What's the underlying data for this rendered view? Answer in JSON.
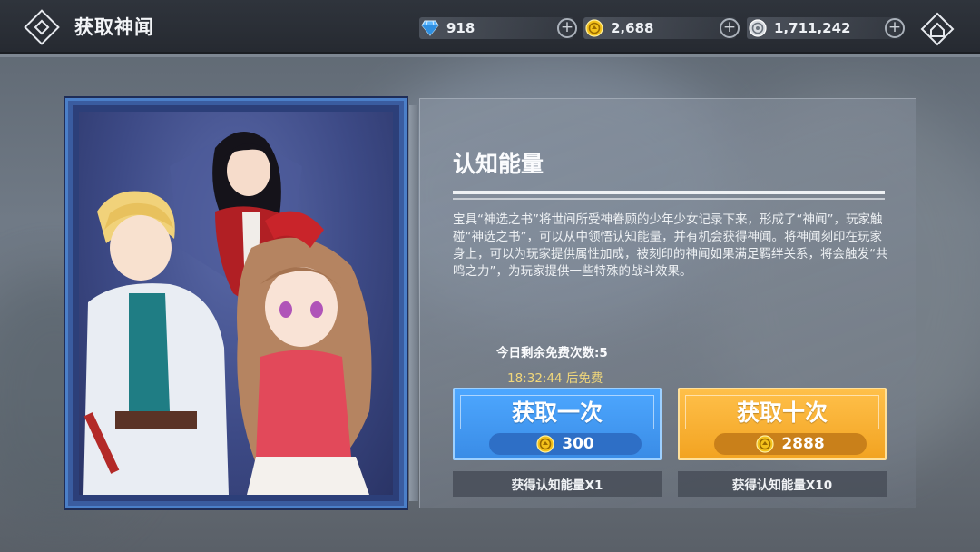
{
  "header": {
    "title": "获取神闻"
  },
  "currencies": [
    {
      "icon": "diamond-icon",
      "value": "918"
    },
    {
      "icon": "gold-coin-icon",
      "value": "2,688"
    },
    {
      "icon": "silver-coin-icon",
      "value": "1,711,242"
    }
  ],
  "panel": {
    "title": "认知能量",
    "description": "宝具“神选之书”将世间所受神眷顾的少年少女记录下来，形成了“神闻”，玩家触碰“神选之书”，可以从中领悟认知能量，并有机会获得神闻。将神闻刻印在玩家身上，可以为玩家提供属性加成，被刻印的神闻如果满足羁绊关系，将会触发“共鸣之力”，为玩家提供一些特殊的战斗效果。",
    "free_count": "今日剩余免费次数:5",
    "free_timer": "18:32:44 后免费"
  },
  "draw_once": {
    "label": "获取一次",
    "price": "300",
    "reward": "获得认知能量X1"
  },
  "draw_ten": {
    "label": "获取十次",
    "price": "2888",
    "reward": "获得认知能量X10"
  },
  "colors": {
    "blue_button": "#3a8ce6",
    "gold_button": "#f2a321",
    "card_border": "#4b7fc8",
    "timer_text": "#f1d77a"
  }
}
